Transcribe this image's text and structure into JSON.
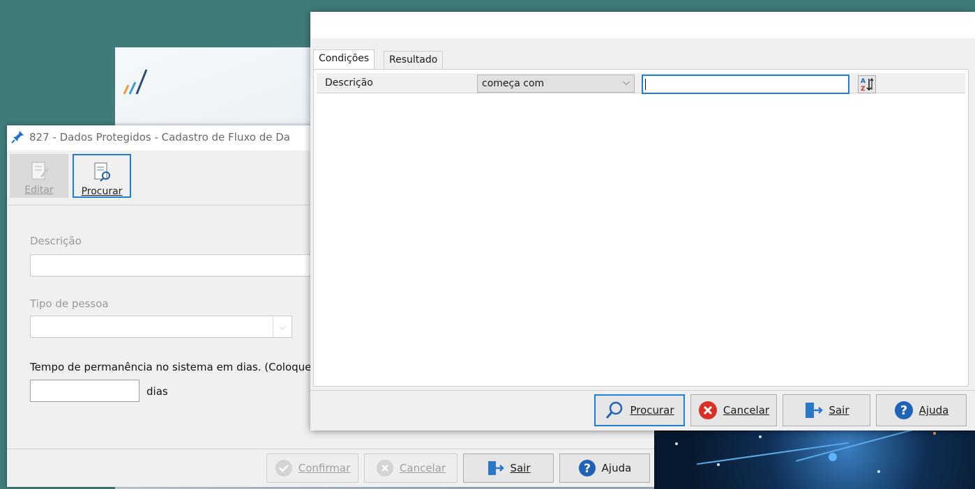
{
  "back_window": {
    "title": "827 - Dados Protegidos - Cadastro de Fluxo de Da",
    "toolbar": {
      "editar": "Editar",
      "procurar": "Procurar"
    },
    "form": {
      "descricao_label": "Descrição",
      "tipo_pessoa_label": "Tipo de pessoa",
      "tempo_label": "Tempo de permanência no sistema em dias. (Coloque",
      "dias_label": "dias"
    },
    "footer": {
      "confirmar": "Confirmar",
      "cancelar": "Cancelar",
      "sair": "Sair",
      "ajuda": "Ajuda"
    }
  },
  "search_dialog": {
    "tabs": [
      "Condições",
      "Resultado"
    ],
    "condition": {
      "field": "Descrição",
      "operator": "começa com",
      "value": ""
    },
    "footer": {
      "procurar": "Procurar",
      "cancelar": "Cancelar",
      "sair": "Sair",
      "ajuda": "Ajuda"
    }
  },
  "colors": {
    "accent": "#1f7ed6",
    "cancel_red": "#d93025",
    "help_blue": "#1e63b8",
    "desktop": "#3f7b79"
  }
}
